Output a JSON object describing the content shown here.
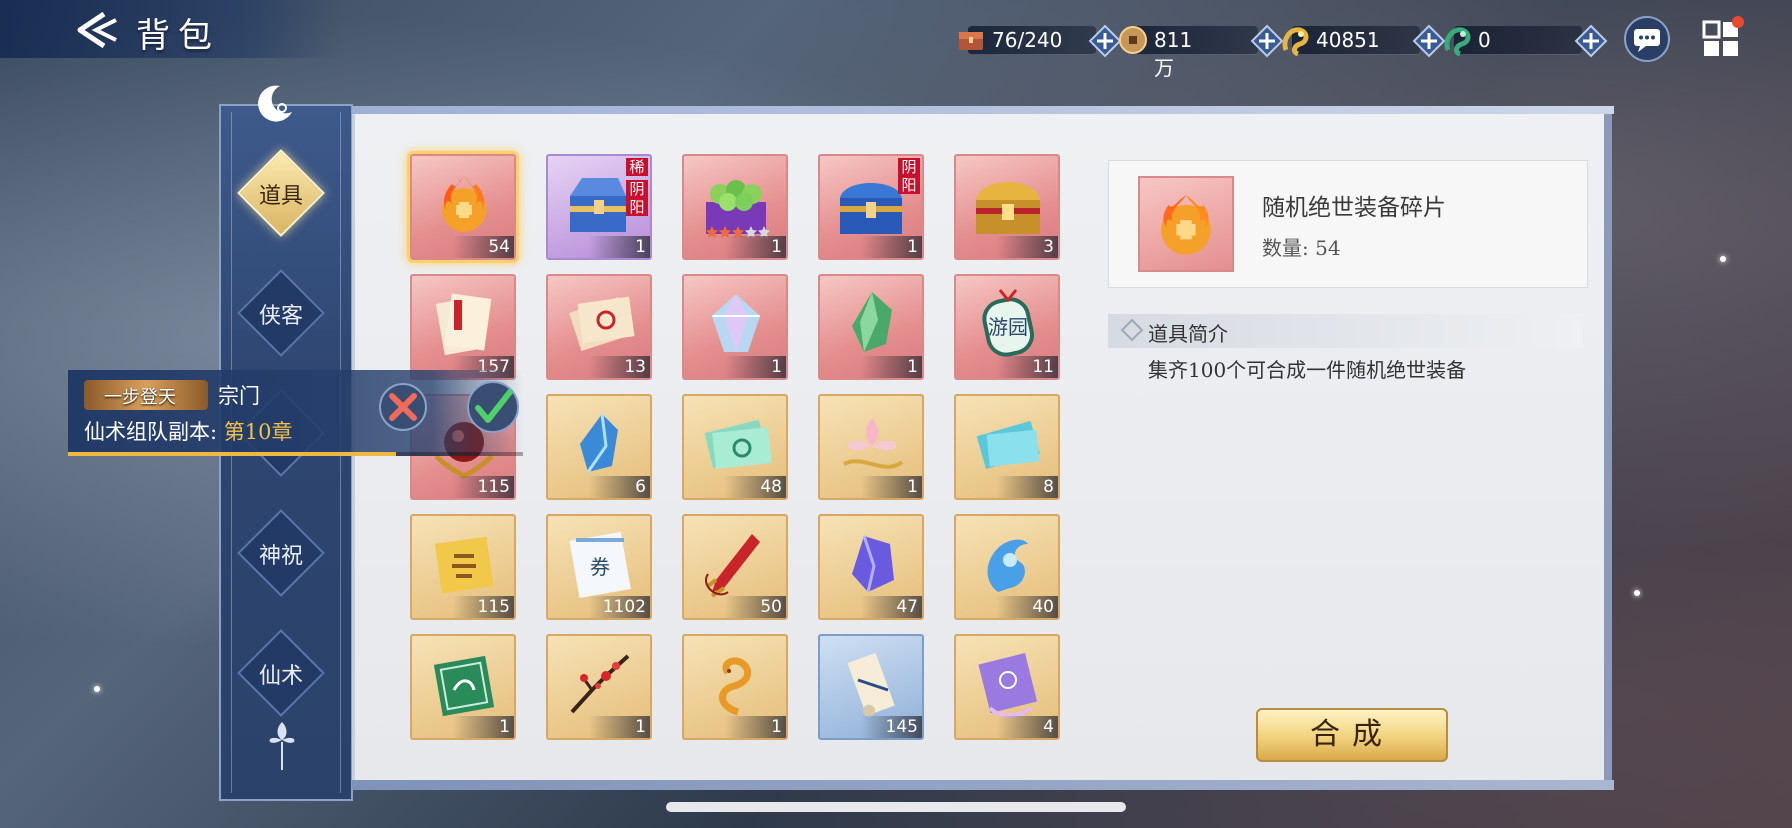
{
  "header": {
    "title": "背包"
  },
  "resources": [
    {
      "name": "bag-capacity",
      "value": "76/240",
      "icon": "chest-icon"
    },
    {
      "name": "copper-coins",
      "value": "811万",
      "icon": "coin-icon"
    },
    {
      "name": "gold-dragon",
      "value": "40851",
      "icon": "gold-dragon-icon"
    },
    {
      "name": "jade-dragon",
      "value": "0",
      "icon": "jade-dragon-icon"
    }
  ],
  "nav": {
    "tabs": [
      "道具",
      "侠客",
      "",
      "神祝",
      "仙术"
    ],
    "active": 0
  },
  "items": [
    {
      "count": "54",
      "color": "red",
      "selected": true,
      "icon": "fire-orb-icon"
    },
    {
      "count": "1",
      "color": "purple",
      "tag": "稀",
      "tag2": "阴阳",
      "icon": "blue-chest-icon"
    },
    {
      "count": "1",
      "color": "red",
      "icon": "green-gem-box-icon",
      "stars": 3
    },
    {
      "count": "1",
      "color": "red",
      "tag": "阴阳",
      "icon": "blue-treasure-chest-icon"
    },
    {
      "count": "3",
      "color": "red",
      "icon": "gold-chest-icon"
    },
    {
      "count": "157",
      "color": "red",
      "icon": "scroll-bundle-icon"
    },
    {
      "count": "13",
      "color": "red",
      "icon": "voucher-icon"
    },
    {
      "count": "1",
      "color": "red",
      "icon": "crystal-icon"
    },
    {
      "count": "1",
      "color": "red",
      "icon": "green-jade-icon"
    },
    {
      "count": "11",
      "color": "red",
      "icon": "tour-token-icon",
      "inner": "游园"
    },
    {
      "count": "115",
      "color": "red",
      "icon": "red-orb-icon"
    },
    {
      "count": "6",
      "color": "gold",
      "icon": "blue-crystal-icon"
    },
    {
      "count": "48",
      "color": "gold",
      "icon": "green-scroll-icon"
    },
    {
      "count": "1",
      "color": "gold",
      "icon": "lotus-icon"
    },
    {
      "count": "8",
      "color": "gold",
      "icon": "cyan-ticket-icon"
    },
    {
      "count": "115",
      "color": "gold",
      "icon": "gold-talisman-icon"
    },
    {
      "count": "1102",
      "color": "gold",
      "icon": "coupon-icon",
      "inner": "券"
    },
    {
      "count": "50",
      "color": "gold",
      "icon": "red-sword-icon"
    },
    {
      "count": "47",
      "color": "gold",
      "icon": "purple-crystal-icon"
    },
    {
      "count": "40",
      "color": "gold",
      "icon": "blue-flame-icon"
    },
    {
      "count": "1",
      "color": "gold",
      "icon": "green-stamp-icon"
    },
    {
      "count": "1",
      "color": "gold",
      "icon": "plum-branch-icon"
    },
    {
      "count": "1",
      "color": "gold",
      "icon": "gold-snake-icon"
    },
    {
      "count": "145",
      "color": "blue",
      "icon": "scroll-icon"
    },
    {
      "count": "4",
      "color": "gold",
      "icon": "purple-talisman-icon"
    }
  ],
  "detail": {
    "name": "随机绝世装备碎片",
    "quantity_label": "数量: 54",
    "intro_title": "道具简介",
    "intro_desc": "集齐100个可合成一件随机绝世装备",
    "combine_label": "合成"
  },
  "notification": {
    "badge": "一步登天",
    "sect": "宗门",
    "line_prefix": "仙术组队副本: ",
    "chapter": "第10章",
    "progress": 0.72
  },
  "colors": {
    "accent_gold": "#f2c14a",
    "panel": "#eef0f3",
    "nav": "#2e4670"
  }
}
